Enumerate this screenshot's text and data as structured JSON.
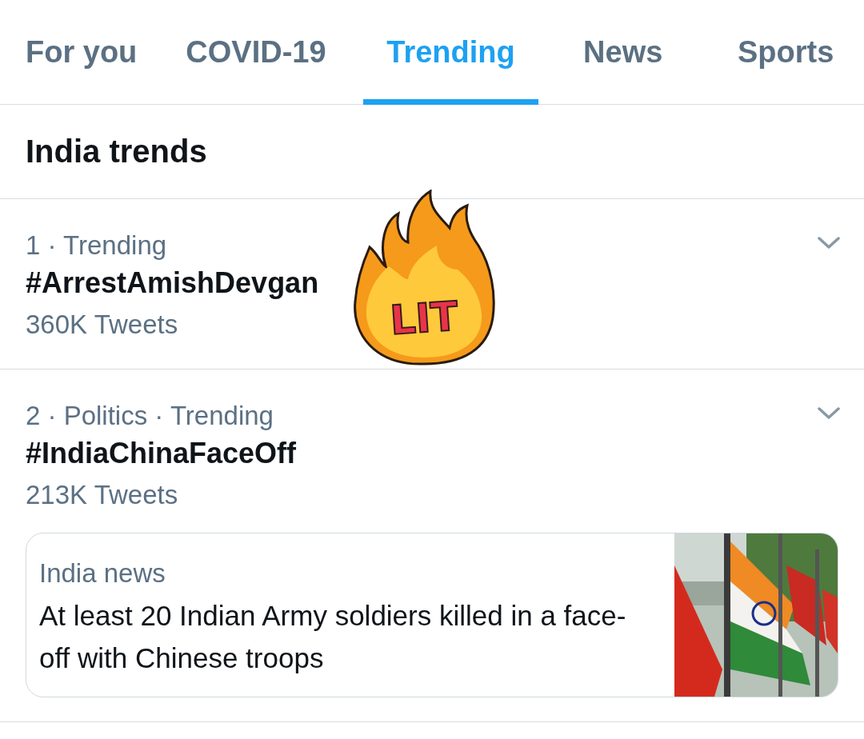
{
  "tabs": [
    {
      "label": "For you",
      "selected": false
    },
    {
      "label": "COVID-19",
      "selected": false
    },
    {
      "label": "Trending",
      "selected": true
    },
    {
      "label": "News",
      "selected": false
    },
    {
      "label": "Sports",
      "selected": false
    }
  ],
  "section_title": "India trends",
  "trends": [
    {
      "meta": "1 · Trending",
      "title": "#ArrestAmishDevgan",
      "count": "360K Tweets",
      "sticker": {
        "text": "LIT"
      }
    },
    {
      "meta": "2 · Politics · Trending",
      "title": "#IndiaChinaFaceOff",
      "count": "213K Tweets",
      "news_card": {
        "source": "India news",
        "headline": "At least 20 Indian Army soldiers killed in a face-off with Chinese troops"
      }
    }
  ]
}
